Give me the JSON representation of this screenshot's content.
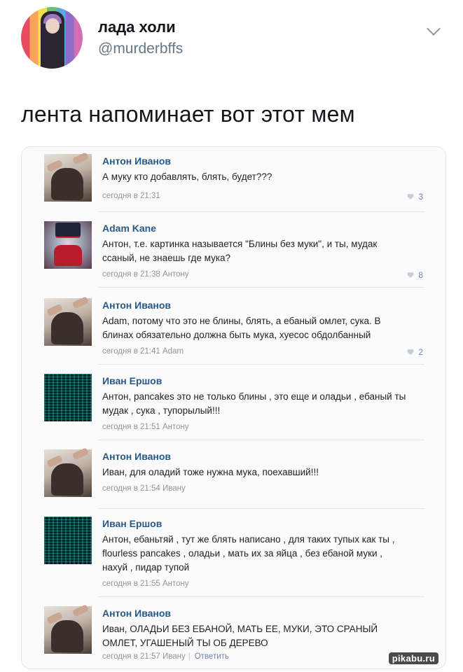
{
  "tweet": {
    "display_name": "лада холи",
    "handle": "@murderbffs",
    "text": "лента напоминает вот этот мем",
    "menu_icon": "chevron-down-icon"
  },
  "screenshot": {
    "watermark": "pikabu.ru",
    "comments": [
      {
        "author": "Антон Иванов",
        "avatar": "anton",
        "text": "А муку кто добавлять, блять, будет???",
        "meta": "сегодня в 21:31",
        "likes": "3"
      },
      {
        "author": "Adam Kane",
        "avatar": "adam",
        "text": "Антон, т.е. картинка называется \"Блины без муки\", и ты, мудак ссаный, не знаешь где мука?",
        "meta": "сегодня в 21:38 Антону",
        "likes": "8"
      },
      {
        "author": "Антон Иванов",
        "avatar": "anton",
        "text": "Adam, потому что это не блины, блять, а ебаный омлет, сука. В блинах обязательно должна быть мука, хуесос обдолбанный",
        "meta": "сегодня в 21:41 Adam",
        "likes": "2"
      },
      {
        "author": "Иван Ершов",
        "avatar": "ivan",
        "text": "Антон, pancakes это не только блины , это еще и оладьи , ебаный ты мудак , сука , тупорылый!!!",
        "meta": "сегодня в 21:51 Антону",
        "likes": ""
      },
      {
        "author": "Антон Иванов",
        "avatar": "anton",
        "text": "Иван, для оладий тоже нужна мука, поехавший!!!",
        "meta": "сегодня в 21:54 Ивану",
        "likes": ""
      },
      {
        "author": "Иван Ершов",
        "avatar": "ivan",
        "text": "Антон, ебаньтяй , тут же блять написано , для таких тупых как ты , flourless pancakes , оладьи , мать их за яйца , без ебаной муки , нахуй , пидар тупой",
        "meta": "сегодня в 21:55 Антону",
        "likes": ""
      },
      {
        "author": "Антон Иванов",
        "avatar": "anton",
        "text": "Иван, ОЛАДЬИ БЕЗ ЕБАНОЙ, МАТЬ ЕЕ, МУКИ, ЭТО СРАНЫЙ ОМЛЕТ, УГАШЕНЫЙ ТЫ ОБ ДЕРЕВО",
        "meta": "сегодня в 21:57 Ивану",
        "reply_label": "Ответить",
        "likes": ""
      }
    ]
  }
}
